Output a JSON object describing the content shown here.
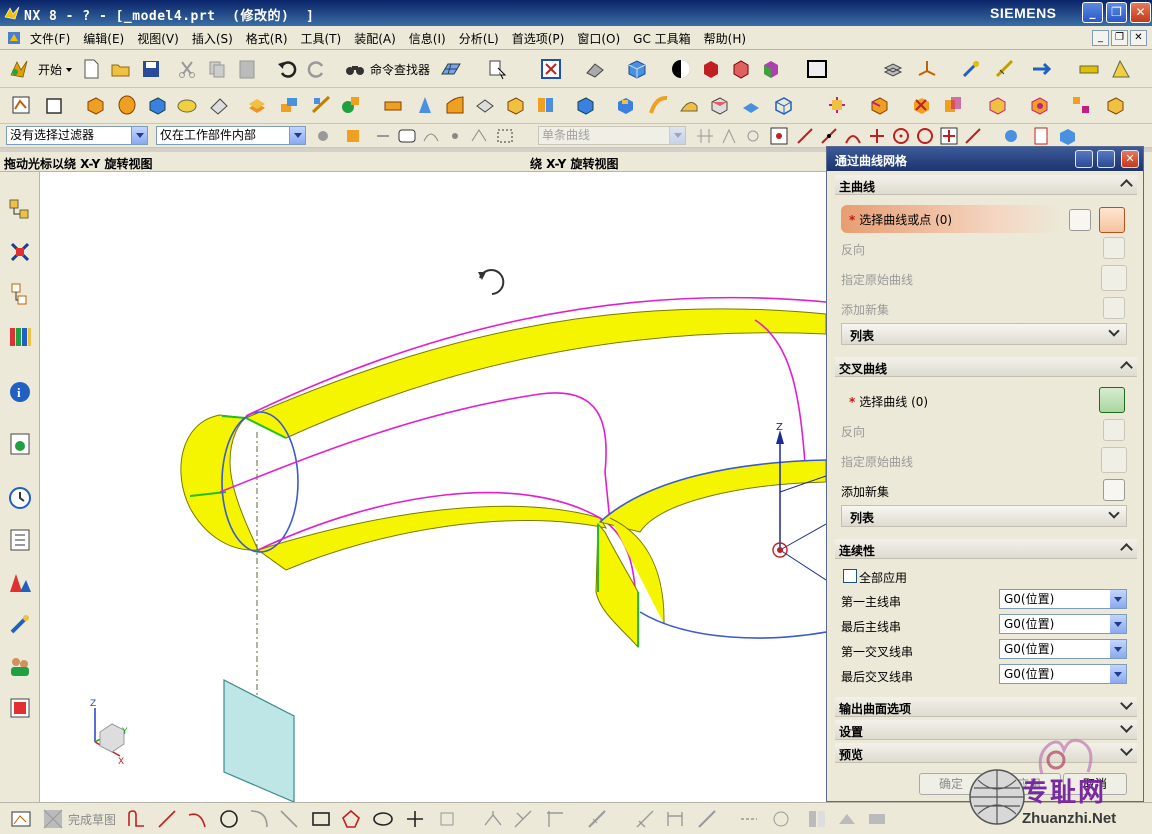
{
  "window": {
    "title": "NX 8 - ? - [_model4.prt  (修改的)  ]",
    "brand": "SIEMENS"
  },
  "menubar": {
    "items": [
      "文件(F)",
      "编辑(E)",
      "视图(V)",
      "插入(S)",
      "格式(R)",
      "工具(T)",
      "装配(A)",
      "信息(I)",
      "分析(L)",
      "首选项(P)",
      "窗口(O)",
      "GC 工具箱",
      "帮助(H)"
    ]
  },
  "toolbar": {
    "start_label": "开始",
    "command_finder_label": "命令查找器"
  },
  "filterbar": {
    "selection_filter": "没有选择过滤器",
    "scope": "仅在工作部件内部",
    "curve_rule": "单条曲线"
  },
  "viewport": {
    "left_caption": "拖动光标以绕 X-Y 旋转视图",
    "right_caption": "绕 X-Y 旋转视图"
  },
  "colors": {
    "surface_yellow": "#f5f500",
    "curve_magenta": "#e020d0",
    "edge_blue": "#3a5ad0",
    "plane_cyan": "#bfe6e6"
  },
  "dialog": {
    "title": "通过曲线网格",
    "primary_section": {
      "title": "主曲线",
      "select_label": "选择曲线或点 (0)",
      "reverse": "反向",
      "specify_origin": "指定原始曲线",
      "add_set": "添加新集",
      "list": "列表"
    },
    "cross_section": {
      "title": "交叉曲线",
      "select_label": "选择曲线 (0)",
      "reverse": "反向",
      "specify_origin": "指定原始曲线",
      "add_set": "添加新集",
      "list": "列表"
    },
    "continuity": {
      "title": "连续性",
      "apply_all": "全部应用",
      "rows": [
        {
          "label": "第一主线串",
          "value": "G0(位置)"
        },
        {
          "label": "最后主线串",
          "value": "G0(位置)"
        },
        {
          "label": "第一交叉线串",
          "value": "G0(位置)"
        },
        {
          "label": "最后交叉线串",
          "value": "G0(位置)"
        }
      ]
    },
    "output_options": "输出曲面选项",
    "settings": "设置",
    "preview": "预览",
    "ok_button": "确定",
    "apply_button": "应用",
    "cancel_button": "取消"
  },
  "bottombar": {
    "finish_sketch": "完成草图"
  },
  "watermark": {
    "brand": "专耻网",
    "url": "Zhuanzhi.Net"
  }
}
